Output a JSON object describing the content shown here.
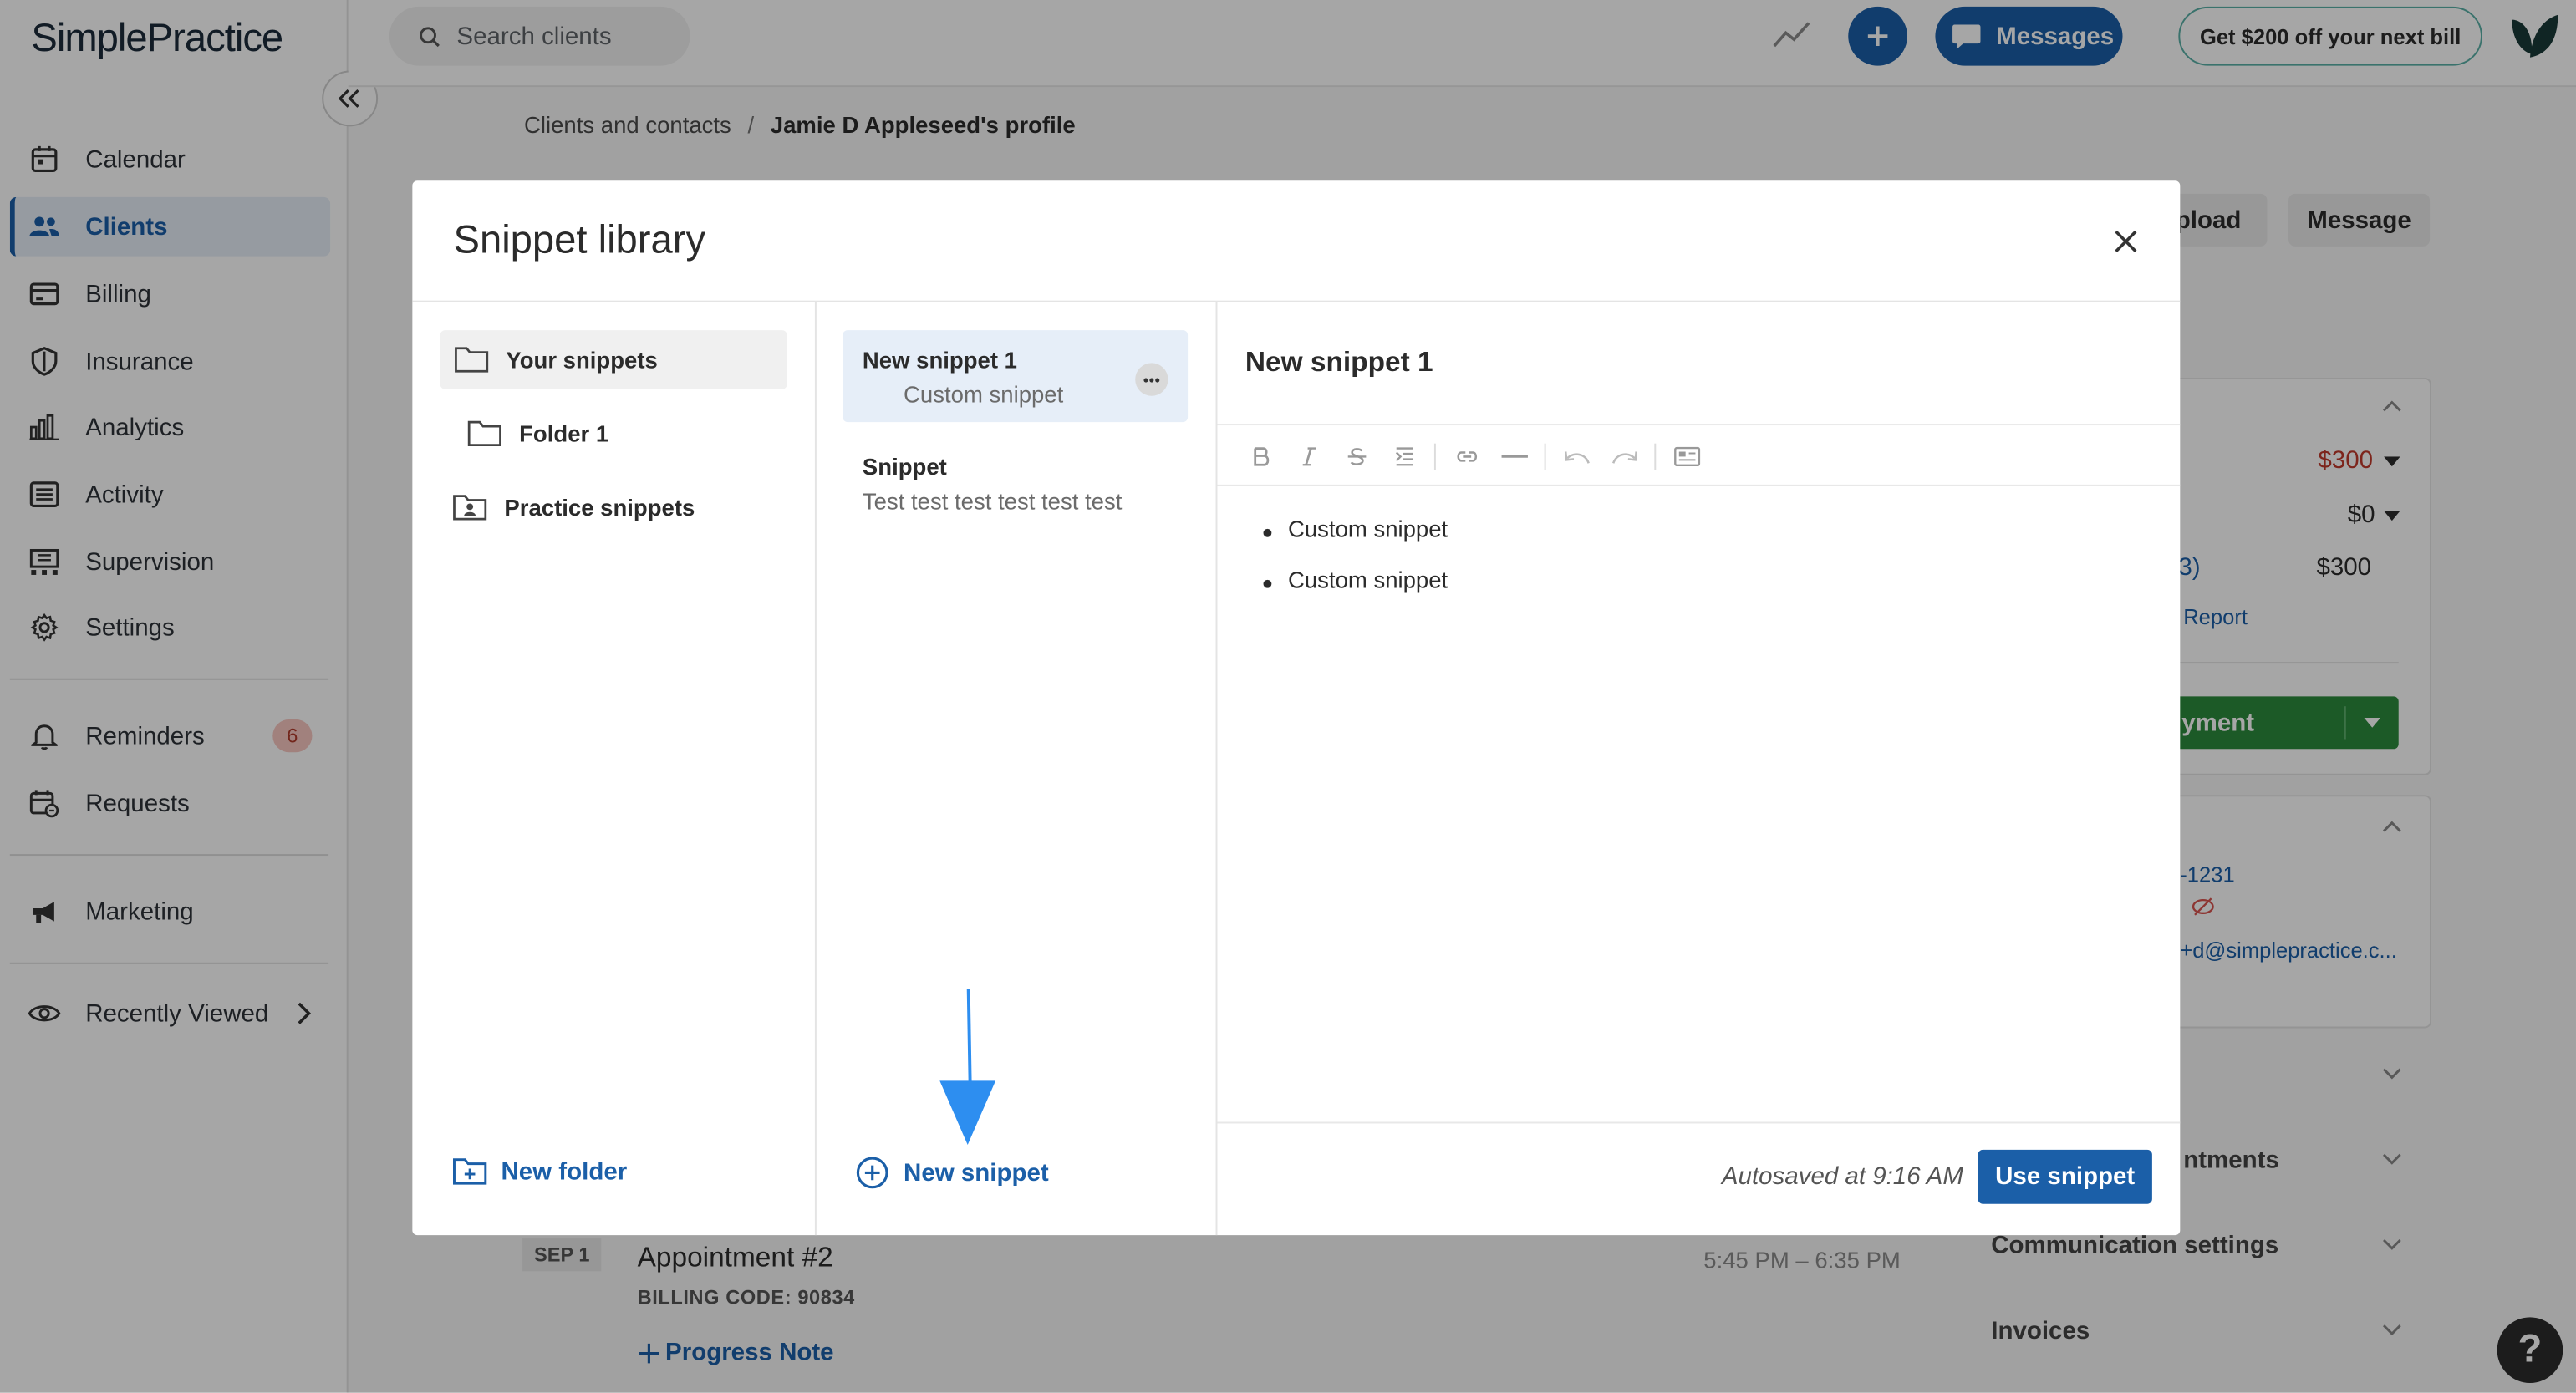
{
  "app": {
    "logo_text": "SimplePractice"
  },
  "sidebar": {
    "items": [
      {
        "label": "Calendar",
        "icon": "calendar-icon"
      },
      {
        "label": "Clients",
        "icon": "clients-icon",
        "active": true
      },
      {
        "label": "Billing",
        "icon": "billing-icon"
      },
      {
        "label": "Insurance",
        "icon": "shield-icon"
      },
      {
        "label": "Analytics",
        "icon": "analytics-icon"
      },
      {
        "label": "Activity",
        "icon": "activity-icon"
      },
      {
        "label": "Supervision",
        "icon": "supervision-icon"
      },
      {
        "label": "Settings",
        "icon": "gear-icon"
      }
    ],
    "reminders": {
      "label": "Reminders",
      "count": "6"
    },
    "requests": {
      "label": "Requests"
    },
    "marketing": {
      "label": "Marketing"
    },
    "recently_viewed": {
      "label": "Recently Viewed"
    }
  },
  "topbar": {
    "search_placeholder": "Search clients",
    "messages_label": "Messages",
    "promo_label": "Get $200 off your next bill"
  },
  "breadcrumb": {
    "parent": "Clients and contacts",
    "separator": "/",
    "current": "Jamie D Appleseed's profile"
  },
  "profile_actions": {
    "upload_label": "Jpload",
    "message_label": "Message"
  },
  "billing_card": {
    "amount_1": "$300",
    "amount_2": "$0",
    "row3_link": "3)",
    "amount_3": "$300",
    "report_link": "Report",
    "payment_button": "yment"
  },
  "contact_card": {
    "phone_fragment": "-1231",
    "email_fragment": "+d@simplepractice.c..."
  },
  "right_sections": [
    {
      "label": "ntments"
    },
    {
      "label": "Communication settings"
    },
    {
      "label": "Invoices"
    }
  ],
  "appointment": {
    "date": "SEP 1",
    "title": "Appointment #2",
    "billing_code": "BILLING CODE: 90834",
    "time": "5:45 PM – 6:35 PM",
    "progress_note": "Progress Note"
  },
  "help_label": "?",
  "modal": {
    "title": "Snippet library",
    "folders": [
      {
        "label": "Your snippets",
        "selected": true
      },
      {
        "label": "Folder 1"
      },
      {
        "label": "Practice snippets"
      }
    ],
    "new_folder_label": "New folder",
    "snippets": [
      {
        "title": "New snippet 1",
        "subtitle": "Custom snippet",
        "selected": true
      },
      {
        "title": "Snippet",
        "subtitle": "Test test test test test test"
      }
    ],
    "new_snippet_label": "New snippet",
    "editor": {
      "title": "New snippet 1",
      "bullets": [
        "Custom snippet",
        "Custom snippet"
      ],
      "autosaved": "Autosaved at 9:16 AM",
      "use_button": "Use snippet"
    }
  },
  "colors": {
    "primary": "#1b5fa8",
    "annotation_arrow": "#2d8ef0",
    "badge_bg": "#f7c7c0",
    "green": "#2c8a3c",
    "red_amount": "#c0392b"
  }
}
